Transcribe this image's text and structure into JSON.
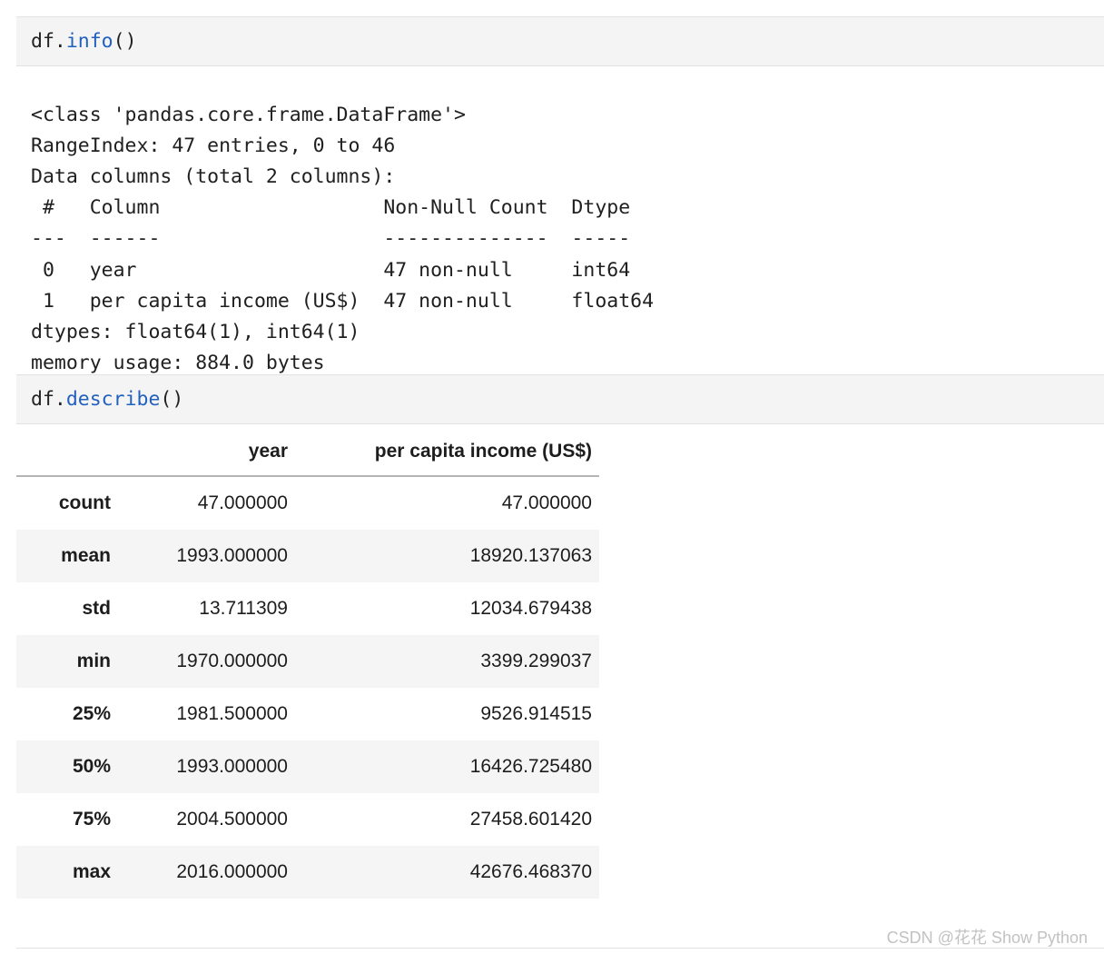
{
  "cells": [
    {
      "kind": "code-input",
      "prefix": "df.",
      "function": "info",
      "suffix": "()"
    },
    {
      "kind": "code-input",
      "prefix": "df.",
      "function": "describe",
      "suffix": "()"
    }
  ],
  "info_output": {
    "lines": [
      "<class 'pandas.core.frame.DataFrame'>",
      "RangeIndex: 47 entries, 0 to 46",
      "Data columns (total 2 columns):",
      " #   Column                  Non-Null Count  Dtype",
      "---  ------                  --------------  -----",
      " 0   year                    47 non-null     int64",
      " 1   per capita income (US$)  47 non-null     float64",
      "dtypes: float64(1), int64(1)",
      "memory usage: 884.0 bytes"
    ],
    "text": "<class 'pandas.core.frame.DataFrame'>\nRangeIndex: 47 entries, 0 to 46\nData columns (total 2 columns):\n #   Column                   Non-Null Count  Dtype\n---  ------                   --------------  -----\n 0   year                     47 non-null     int64\n 1   per capita income (US$)  47 non-null     float64\ndtypes: float64(1), int64(1)\nmemory usage: 884.0 bytes"
  },
  "describe_table": {
    "index_header": "",
    "columns": [
      "year",
      "per capita income (US$)"
    ],
    "rows": [
      {
        "label": "count",
        "year": "47.000000",
        "pci": "47.000000"
      },
      {
        "label": "mean",
        "year": "1993.000000",
        "pci": "18920.137063"
      },
      {
        "label": "std",
        "year": "13.711309",
        "pci": "12034.679438"
      },
      {
        "label": "min",
        "year": "1970.000000",
        "pci": "3399.299037"
      },
      {
        "label": "25%",
        "year": "1981.500000",
        "pci": "9526.914515"
      },
      {
        "label": "50%",
        "year": "1993.000000",
        "pci": "16426.725480"
      },
      {
        "label": "75%",
        "year": "2004.500000",
        "pci": "27458.601420"
      },
      {
        "label": "max",
        "year": "2016.000000",
        "pci": "42676.468370"
      }
    ]
  },
  "watermark": {
    "text": "CSDN @花花 Show Python"
  },
  "colors": {
    "code_keyword_blue": "#2260c0",
    "cell_background": "#f4f4f4",
    "row_stripe": "#f5f5f5",
    "text": "#1d1d1d",
    "watermark": "#c2c2c2"
  }
}
